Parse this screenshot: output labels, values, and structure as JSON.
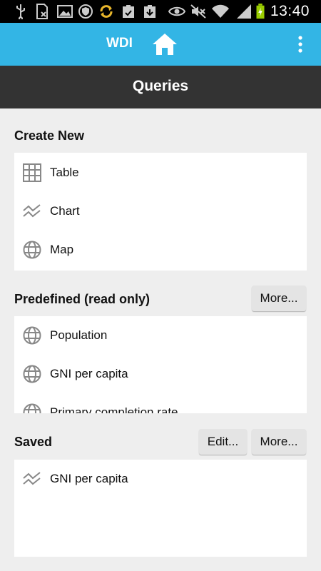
{
  "status_bar": {
    "time": "13:40",
    "icons": [
      "usb-icon",
      "sim-icon",
      "image-icon",
      "shield-icon",
      "sync-icon",
      "clipboard-icon",
      "download-icon",
      "eye-icon",
      "mute-icon",
      "wifi-icon",
      "signal-icon",
      "battery-charging-icon"
    ]
  },
  "action_bar": {
    "app_title": "WDI",
    "accent_color": "#33b5e5"
  },
  "title_bar": {
    "title": "Queries"
  },
  "create_new": {
    "header": "Create New",
    "items": [
      {
        "label": "Table",
        "icon": "table-icon"
      },
      {
        "label": "Chart",
        "icon": "chart-icon"
      },
      {
        "label": "Map",
        "icon": "globe-icon"
      }
    ]
  },
  "predefined": {
    "header": "Predefined (read only)",
    "more_label": "More...",
    "items": [
      {
        "label": "Population",
        "icon": "globe-icon"
      },
      {
        "label": "GNI per capita",
        "icon": "globe-icon"
      },
      {
        "label": "Primary completion rate",
        "icon": "globe-icon"
      }
    ]
  },
  "saved": {
    "header": "Saved",
    "edit_label": "Edit...",
    "more_label": "More...",
    "items": [
      {
        "label": "GNI per capita",
        "icon": "chart-icon"
      }
    ]
  }
}
